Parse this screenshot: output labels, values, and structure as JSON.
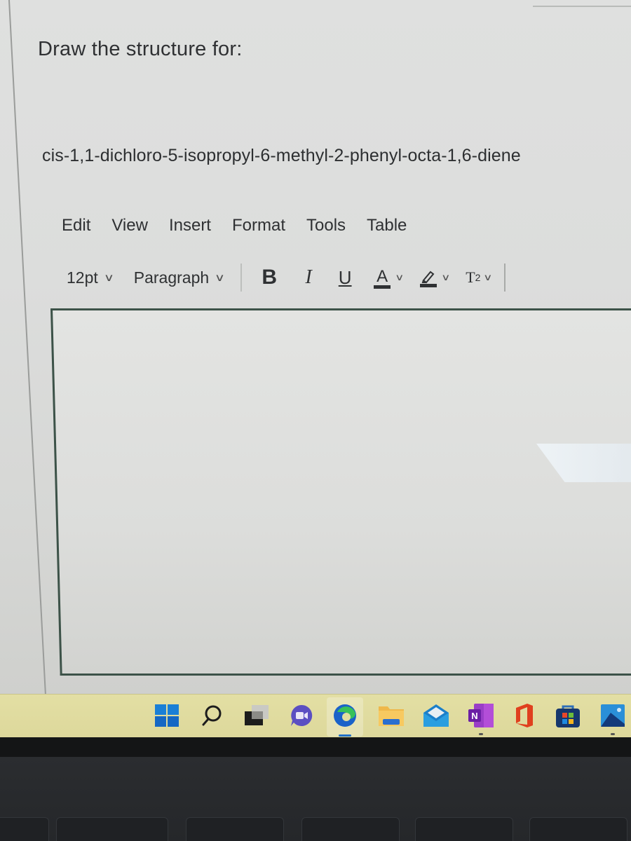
{
  "question": {
    "prompt": "Draw the structure for:",
    "compound_name": "cis-1,1-dichloro-5-isopropyl-6-methyl-2-phenyl-octa-1,6-diene"
  },
  "editor": {
    "menu": [
      {
        "label": "Edit"
      },
      {
        "label": "View"
      },
      {
        "label": "Insert"
      },
      {
        "label": "Format"
      },
      {
        "label": "Tools"
      },
      {
        "label": "Table"
      }
    ],
    "toolbar": {
      "font_size": "12pt",
      "block_format": "Paragraph",
      "bold_label": "B",
      "italic_label": "I",
      "underline_label": "U",
      "text_color_label": "A",
      "superscript_label": "T",
      "superscript_exp": "2",
      "chevron": "∨",
      "text_color": "#2f3133",
      "highlight_color": "#2f3133"
    },
    "content": ""
  },
  "taskbar": {
    "icons": [
      {
        "name": "start",
        "active": false,
        "running": false
      },
      {
        "name": "search",
        "active": false,
        "running": false
      },
      {
        "name": "task-view",
        "active": false,
        "running": false
      },
      {
        "name": "teams-chat",
        "active": false,
        "running": false
      },
      {
        "name": "edge",
        "active": true,
        "running": true
      },
      {
        "name": "file-explorer",
        "active": false,
        "running": false
      },
      {
        "name": "mail",
        "active": false,
        "running": false
      },
      {
        "name": "onenote",
        "active": false,
        "running": true
      },
      {
        "name": "office",
        "active": false,
        "running": false
      },
      {
        "name": "microsoft-store",
        "active": false,
        "running": false
      },
      {
        "name": "photos",
        "active": false,
        "running": true
      }
    ],
    "onenote_letter": "N",
    "background_color": "#e0dc9f"
  }
}
